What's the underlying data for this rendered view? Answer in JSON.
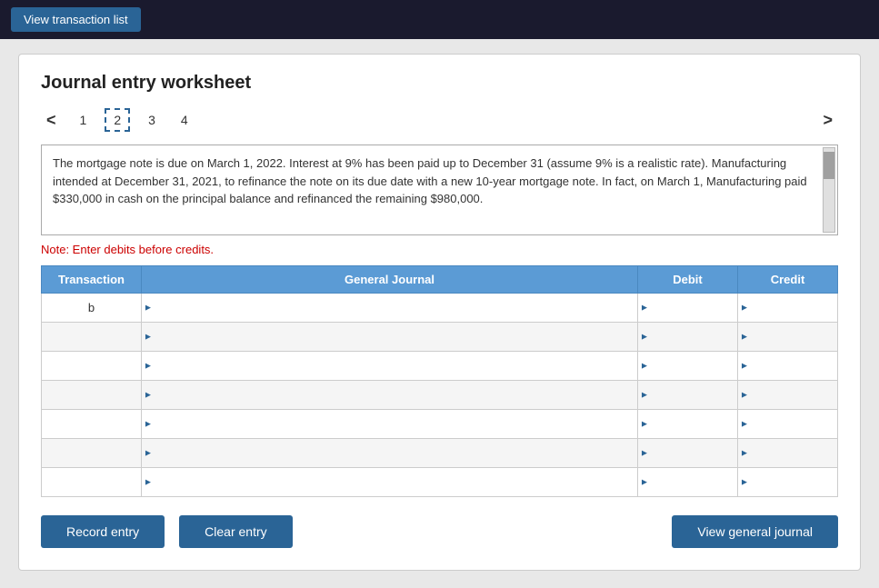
{
  "topbar": {
    "view_transaction_label": "View transaction list"
  },
  "worksheet": {
    "title": "Journal entry worksheet",
    "nav": {
      "prev_arrow": "<",
      "next_arrow": ">",
      "pages": [
        {
          "number": "1",
          "active": false
        },
        {
          "number": "2",
          "active": true
        },
        {
          "number": "3",
          "active": false
        },
        {
          "number": "4",
          "active": false
        }
      ]
    },
    "description": "The mortgage note is due on March 1, 2022. Interest at 9% has been paid up to December 31 (assume 9% is a realistic rate). Manufacturing intended at December 31, 2021, to refinance the note on its due date with a new 10-year mortgage note. In fact, on March 1, Manufacturing paid $330,000 in cash on the principal balance and refinanced the remaining $980,000.",
    "note": "Note: Enter debits before credits.",
    "table": {
      "headers": {
        "transaction": "Transaction",
        "general_journal": "General Journal",
        "debit": "Debit",
        "credit": "Credit"
      },
      "rows": [
        {
          "transaction": "b",
          "journal": "",
          "debit": "",
          "credit": ""
        },
        {
          "transaction": "",
          "journal": "",
          "debit": "",
          "credit": ""
        },
        {
          "transaction": "",
          "journal": "",
          "debit": "",
          "credit": ""
        },
        {
          "transaction": "",
          "journal": "",
          "debit": "",
          "credit": ""
        },
        {
          "transaction": "",
          "journal": "",
          "debit": "",
          "credit": ""
        },
        {
          "transaction": "",
          "journal": "",
          "debit": "",
          "credit": ""
        },
        {
          "transaction": "",
          "journal": "",
          "debit": "",
          "credit": ""
        }
      ]
    },
    "buttons": {
      "record_entry": "Record entry",
      "clear_entry": "Clear entry",
      "view_general_journal": "View general journal"
    }
  }
}
